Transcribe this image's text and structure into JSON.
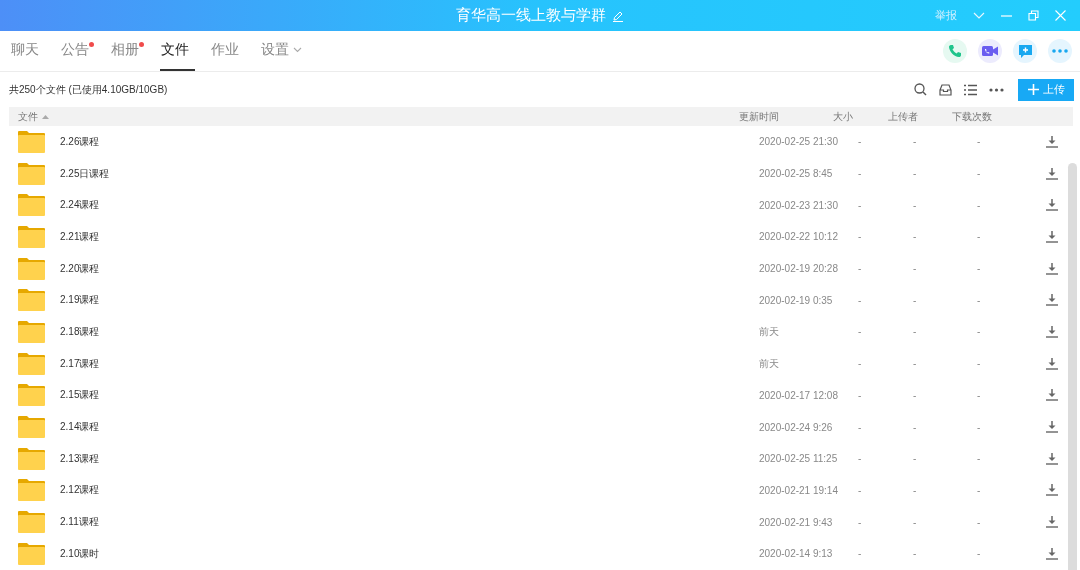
{
  "window": {
    "title": "育华高一线上教与学群",
    "report": "举报"
  },
  "tabs": [
    {
      "label": "聊天",
      "selected": false,
      "dot": false,
      "dropdown": false
    },
    {
      "label": "公告",
      "selected": false,
      "dot": true,
      "dropdown": false
    },
    {
      "label": "相册",
      "selected": false,
      "dot": true,
      "dropdown": false
    },
    {
      "label": "文件",
      "selected": true,
      "dot": false,
      "dropdown": false
    },
    {
      "label": "作业",
      "selected": false,
      "dot": false,
      "dropdown": false
    },
    {
      "label": "设置",
      "selected": false,
      "dot": false,
      "dropdown": true
    }
  ],
  "summary": "共250个文件 (已使用4.10GB/10GB)",
  "upload_button": "上传",
  "table": {
    "columns": [
      "文件",
      "更新时间",
      "大小",
      "上传者",
      "下载次数"
    ],
    "rows": [
      {
        "name": "2.26课程",
        "time": "2020-02-25 21:30",
        "size": "-",
        "uploader": "-",
        "downloads": "-"
      },
      {
        "name": "2.25日课程",
        "time": "2020-02-25 8:45",
        "size": "-",
        "uploader": "-",
        "downloads": "-"
      },
      {
        "name": "2.24课程",
        "time": "2020-02-23 21:30",
        "size": "-",
        "uploader": "-",
        "downloads": "-"
      },
      {
        "name": "2.21课程",
        "time": "2020-02-22 10:12",
        "size": "-",
        "uploader": "-",
        "downloads": "-"
      },
      {
        "name": "2.20课程",
        "time": "2020-02-19 20:28",
        "size": "-",
        "uploader": "-",
        "downloads": "-"
      },
      {
        "name": "2.19课程",
        "time": "2020-02-19 0:35",
        "size": "-",
        "uploader": "-",
        "downloads": "-"
      },
      {
        "name": "2.18课程",
        "time": "前天",
        "size": "-",
        "uploader": "-",
        "downloads": "-"
      },
      {
        "name": "2.17课程",
        "time": "前天",
        "size": "-",
        "uploader": "-",
        "downloads": "-"
      },
      {
        "name": "2.15课程",
        "time": "2020-02-17 12:08",
        "size": "-",
        "uploader": "-",
        "downloads": "-"
      },
      {
        "name": "2.14课程",
        "time": "2020-02-24 9:26",
        "size": "-",
        "uploader": "-",
        "downloads": "-"
      },
      {
        "name": "2.13课程",
        "time": "2020-02-25 11:25",
        "size": "-",
        "uploader": "-",
        "downloads": "-"
      },
      {
        "name": "2.12课程",
        "time": "2020-02-21 19:14",
        "size": "-",
        "uploader": "-",
        "downloads": "-"
      },
      {
        "name": "2.11课程",
        "time": "2020-02-21 9:43",
        "size": "-",
        "uploader": "-",
        "downloads": "-"
      },
      {
        "name": "2.10课时",
        "time": "2020-02-14 9:13",
        "size": "-",
        "uploader": "-",
        "downloads": "-"
      }
    ]
  }
}
